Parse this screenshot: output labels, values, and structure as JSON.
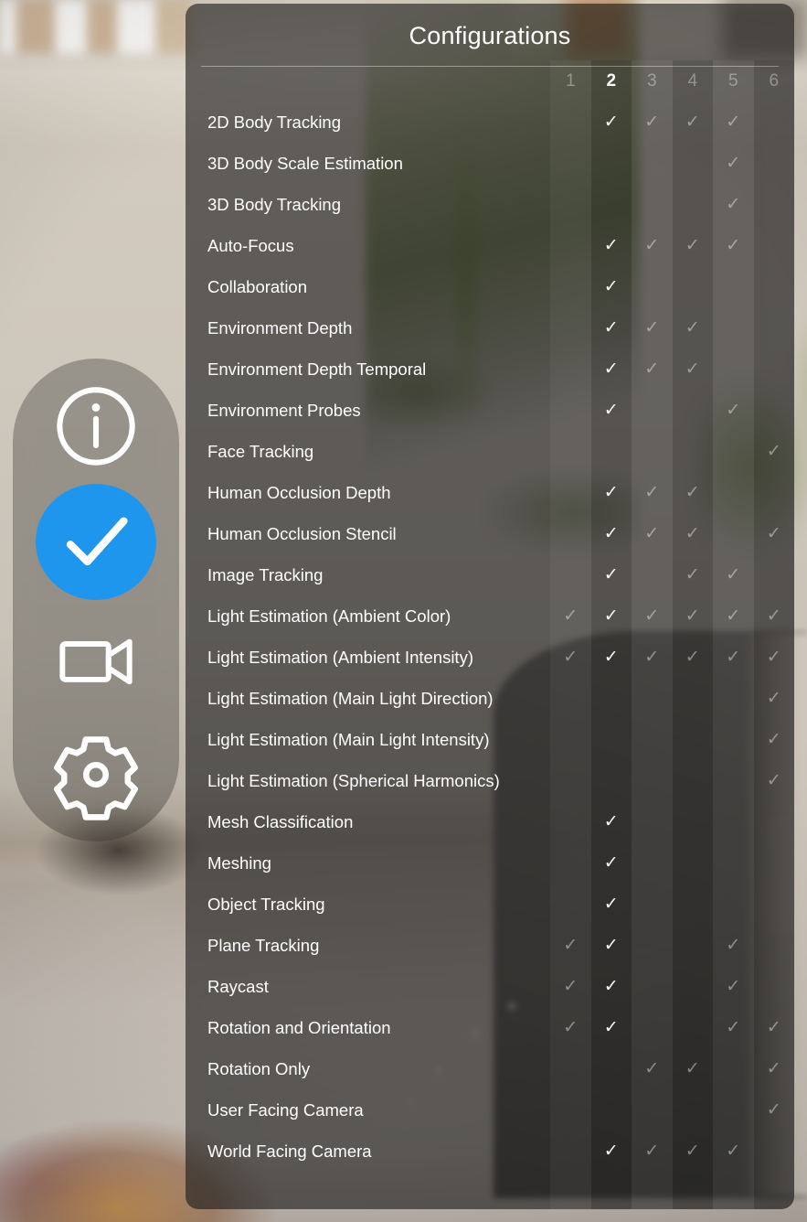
{
  "panel": {
    "title": "Configurations",
    "columns": [
      {
        "label": "1",
        "selected": false
      },
      {
        "label": "2",
        "selected": true
      },
      {
        "label": "3",
        "selected": false
      },
      {
        "label": "4",
        "selected": false
      },
      {
        "label": "5",
        "selected": false
      },
      {
        "label": "6",
        "selected": false
      }
    ],
    "selected_column": 2,
    "rows": [
      {
        "label": "2D Body Tracking",
        "checks": [
          0,
          1,
          1,
          1,
          1,
          0
        ]
      },
      {
        "label": "3D Body Scale Estimation",
        "checks": [
          0,
          0,
          0,
          0,
          1,
          0
        ]
      },
      {
        "label": "3D Body Tracking",
        "checks": [
          0,
          0,
          0,
          0,
          1,
          0
        ]
      },
      {
        "label": "Auto-Focus",
        "checks": [
          0,
          1,
          1,
          1,
          1,
          0
        ]
      },
      {
        "label": "Collaboration",
        "checks": [
          0,
          1,
          0,
          0,
          0,
          0
        ]
      },
      {
        "label": "Environment Depth",
        "checks": [
          0,
          1,
          1,
          1,
          0,
          0
        ]
      },
      {
        "label": "Environment Depth Temporal",
        "checks": [
          0,
          1,
          1,
          1,
          0,
          0
        ]
      },
      {
        "label": "Environment Probes",
        "checks": [
          0,
          1,
          0,
          0,
          1,
          0
        ]
      },
      {
        "label": "Face Tracking",
        "checks": [
          0,
          0,
          0,
          0,
          0,
          1
        ]
      },
      {
        "label": "Human Occlusion Depth",
        "checks": [
          0,
          1,
          1,
          1,
          0,
          0
        ]
      },
      {
        "label": "Human Occlusion Stencil",
        "checks": [
          0,
          1,
          1,
          1,
          0,
          1
        ]
      },
      {
        "label": "Image Tracking",
        "checks": [
          0,
          1,
          0,
          1,
          1,
          0
        ]
      },
      {
        "label": "Light Estimation (Ambient Color)",
        "checks": [
          1,
          1,
          1,
          1,
          1,
          1
        ]
      },
      {
        "label": "Light Estimation (Ambient Intensity)",
        "checks": [
          1,
          1,
          1,
          1,
          1,
          1
        ]
      },
      {
        "label": "Light Estimation (Main Light Direction)",
        "checks": [
          0,
          0,
          0,
          0,
          0,
          1
        ]
      },
      {
        "label": "Light Estimation (Main Light Intensity)",
        "checks": [
          0,
          0,
          0,
          0,
          0,
          1
        ]
      },
      {
        "label": "Light Estimation (Spherical Harmonics)",
        "checks": [
          0,
          0,
          0,
          0,
          0,
          1
        ]
      },
      {
        "label": "Mesh Classification",
        "checks": [
          0,
          1,
          0,
          0,
          0,
          0
        ]
      },
      {
        "label": "Meshing",
        "checks": [
          0,
          1,
          0,
          0,
          0,
          0
        ]
      },
      {
        "label": "Object Tracking",
        "checks": [
          0,
          1,
          0,
          0,
          0,
          0
        ]
      },
      {
        "label": "Plane Tracking",
        "checks": [
          1,
          1,
          0,
          0,
          1,
          0
        ]
      },
      {
        "label": "Raycast",
        "checks": [
          1,
          1,
          0,
          0,
          1,
          0
        ]
      },
      {
        "label": "Rotation and Orientation",
        "checks": [
          1,
          1,
          0,
          0,
          1,
          1
        ]
      },
      {
        "label": "Rotation Only",
        "checks": [
          0,
          0,
          1,
          1,
          0,
          1
        ]
      },
      {
        "label": "User Facing Camera",
        "checks": [
          0,
          0,
          0,
          0,
          0,
          1
        ]
      },
      {
        "label": "World Facing Camera",
        "checks": [
          0,
          1,
          1,
          1,
          1,
          0
        ]
      }
    ],
    "check_glyph": "✓"
  },
  "toolbar": {
    "items": [
      {
        "name": "info-icon",
        "label": "Info",
        "active": false
      },
      {
        "name": "check-icon",
        "label": "Configurations",
        "active": true
      },
      {
        "name": "video-icon",
        "label": "Record",
        "active": false
      },
      {
        "name": "gear-icon",
        "label": "Settings",
        "active": false
      }
    ],
    "active_color": "#1e96ee"
  }
}
